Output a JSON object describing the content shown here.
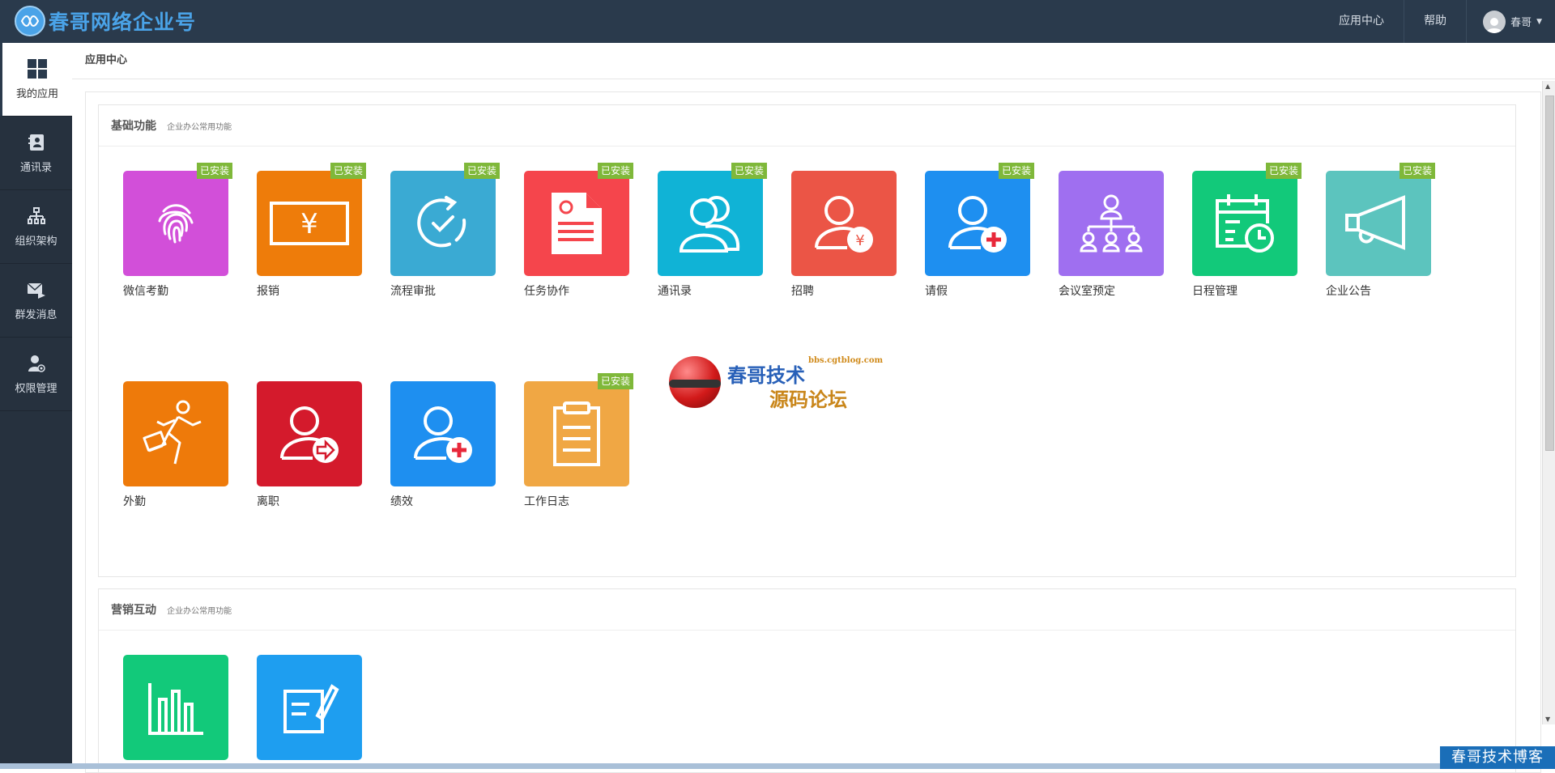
{
  "brand": {
    "name": "春哥网络企业号"
  },
  "topnav": {
    "app_center": "应用中心",
    "help": "帮助",
    "username": "春哥"
  },
  "sidebar": {
    "items": [
      {
        "label": "我的应用",
        "icon": "grid-icon"
      },
      {
        "label": "通讯录",
        "icon": "contacts-book-icon"
      },
      {
        "label": "组织架构",
        "icon": "org-chart-icon"
      },
      {
        "label": "群发消息",
        "icon": "mass-message-icon"
      },
      {
        "label": "权限管理",
        "icon": "permission-user-icon"
      }
    ]
  },
  "breadcrumb": "应用中心",
  "sections": {
    "basic": {
      "title": "基础功能",
      "subtitle": "企业办公常用功能"
    },
    "marketing": {
      "title": "营销互动",
      "subtitle": "企业办公常用功能"
    }
  },
  "badge_installed": "已安装",
  "apps": [
    {
      "label": "微信考勤",
      "color": "#d24fd9",
      "icon": "fingerprint-icon",
      "installed": true
    },
    {
      "label": "报销",
      "color": "#ee7c0a",
      "icon": "yen-card-icon",
      "installed": true
    },
    {
      "label": "流程审批",
      "color": "#3aaad3",
      "icon": "refresh-check-icon",
      "installed": true
    },
    {
      "label": "任务协作",
      "color": "#f5454c",
      "icon": "document-icon",
      "installed": true
    },
    {
      "label": "通讯录",
      "color": "#10b3d6",
      "icon": "users-icon",
      "installed": true
    },
    {
      "label": "招聘",
      "color": "#eb5546",
      "icon": "user-yen-icon",
      "installed": false
    },
    {
      "label": "请假",
      "color": "#1e8ff0",
      "icon": "user-plus-icon",
      "installed": true
    },
    {
      "label": "会议室预定",
      "color": "#9f6ff0",
      "icon": "hierarchy-icon",
      "installed": false
    },
    {
      "label": "日程管理",
      "color": "#12c97a",
      "icon": "calendar-clock-icon",
      "installed": true
    },
    {
      "label": "企业公告",
      "color": "#5cc4be",
      "icon": "megaphone-icon",
      "installed": true
    },
    {
      "label": "外勤",
      "color": "#ee7a0a",
      "icon": "running-man-icon",
      "installed": false
    },
    {
      "label": "离职",
      "color": "#d41a2c",
      "icon": "user-exit-icon",
      "installed": false
    },
    {
      "label": "绩效",
      "color": "#1e8ff0",
      "icon": "user-plus-icon",
      "installed": false
    },
    {
      "label": "工作日志",
      "color": "#f0a744",
      "icon": "clipboard-icon",
      "installed": true
    }
  ],
  "marketing_apps": [
    {
      "label": "",
      "color": "#12c97a",
      "icon": "bar-chart-icon"
    },
    {
      "label": "",
      "color": "#1e9ef0",
      "icon": "edit-note-icon"
    }
  ],
  "watermark": {
    "title": "春哥技术",
    "subtitle": "源码论坛",
    "url": "bbs.cgtblog.com"
  },
  "corner_watermark": "春哥技术博客"
}
